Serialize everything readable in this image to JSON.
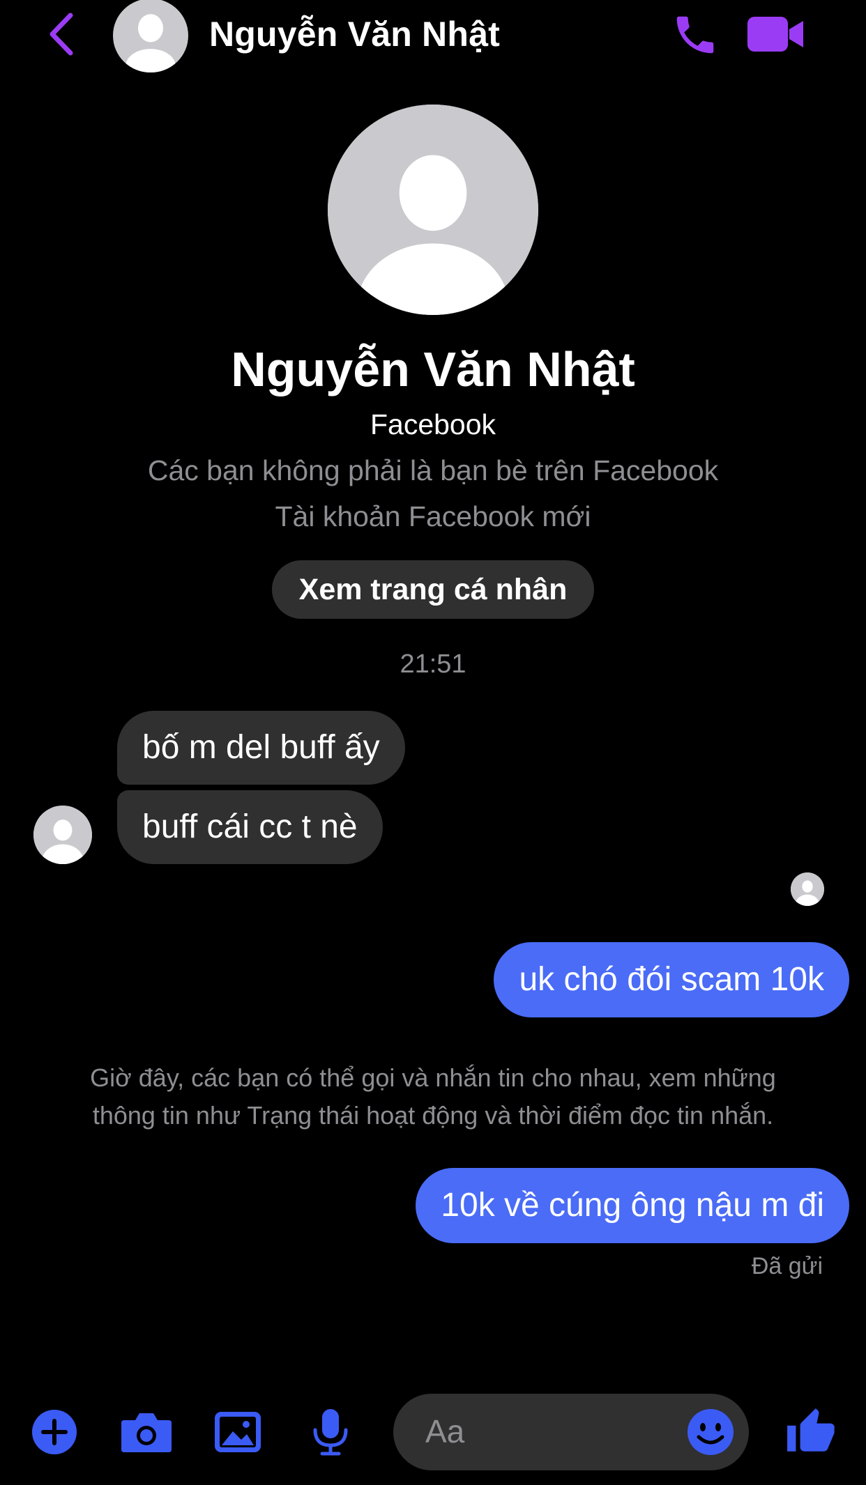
{
  "header": {
    "title": "Nguyễn Văn Nhật",
    "icons": {
      "back": "chevron-left-icon",
      "call": "phone-icon",
      "video": "video-camera-icon"
    }
  },
  "profile": {
    "name": "Nguyễn Văn Nhật",
    "platform": "Facebook",
    "friend_status": "Các bạn không phải là bạn bè trên Facebook",
    "account_note": "Tài khoản Facebook mới",
    "view_profile_label": "Xem trang cá nhân"
  },
  "timestamp": "21:51",
  "messages": [
    {
      "direction": "incoming",
      "text": "bố m del buff ấy"
    },
    {
      "direction": "incoming",
      "text": "buff cái cc t nè"
    },
    {
      "direction": "outgoing",
      "text": "uk chó đói scam 10k"
    },
    {
      "direction": "outgoing",
      "text": "10k về cúng ông nậu m đi"
    }
  ],
  "system_note": {
    "line1": "Giờ đây, các bạn có thể gọi và nhắn tin cho nhau, xem những",
    "line2": "thông tin như Trạng thái hoạt động và thời điểm đọc tin nhắn."
  },
  "sent_status": "Đã gửi",
  "composer": {
    "placeholder": "Aa",
    "icons": [
      "plus-icon",
      "camera-icon",
      "photo-icon",
      "microphone-icon",
      "emoji-icon",
      "thumbs-up-icon"
    ]
  },
  "colors": {
    "background": "#000000",
    "header_accent": "#9b3cf5",
    "composer_accent": "#3b5bf5",
    "outgoing_bubble": "#4a6cf7",
    "incoming_bubble": "#303030",
    "muted_text": "#8e8e93"
  }
}
